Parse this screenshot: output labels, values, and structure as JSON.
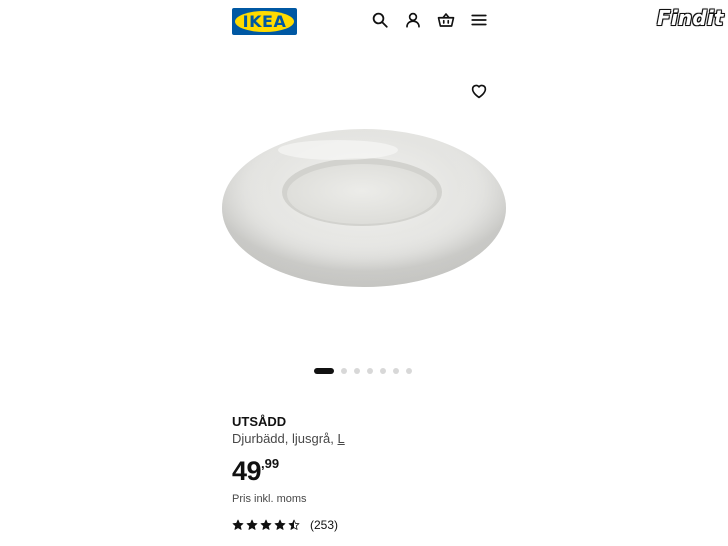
{
  "header": {
    "logo_text": "IKEA",
    "icons": [
      "search-icon",
      "account-icon",
      "basket-icon",
      "menu-icon"
    ],
    "watermark": "Findit"
  },
  "product": {
    "name": "UTSÅDD",
    "description": "Djurbädd, ljusgrå, ",
    "size": "L",
    "price_integer": "49",
    "price_decimals": ",99",
    "vat_note": "Pris inkl. moms",
    "rating": 4.5,
    "rating_max": 5,
    "review_count": "(253)"
  },
  "gallery": {
    "image_count": 7,
    "active_index": 0
  },
  "colors": {
    "brand_blue": "#0058a3",
    "brand_yellow": "#ffdb00",
    "text": "#111111",
    "muted": "#484848"
  }
}
